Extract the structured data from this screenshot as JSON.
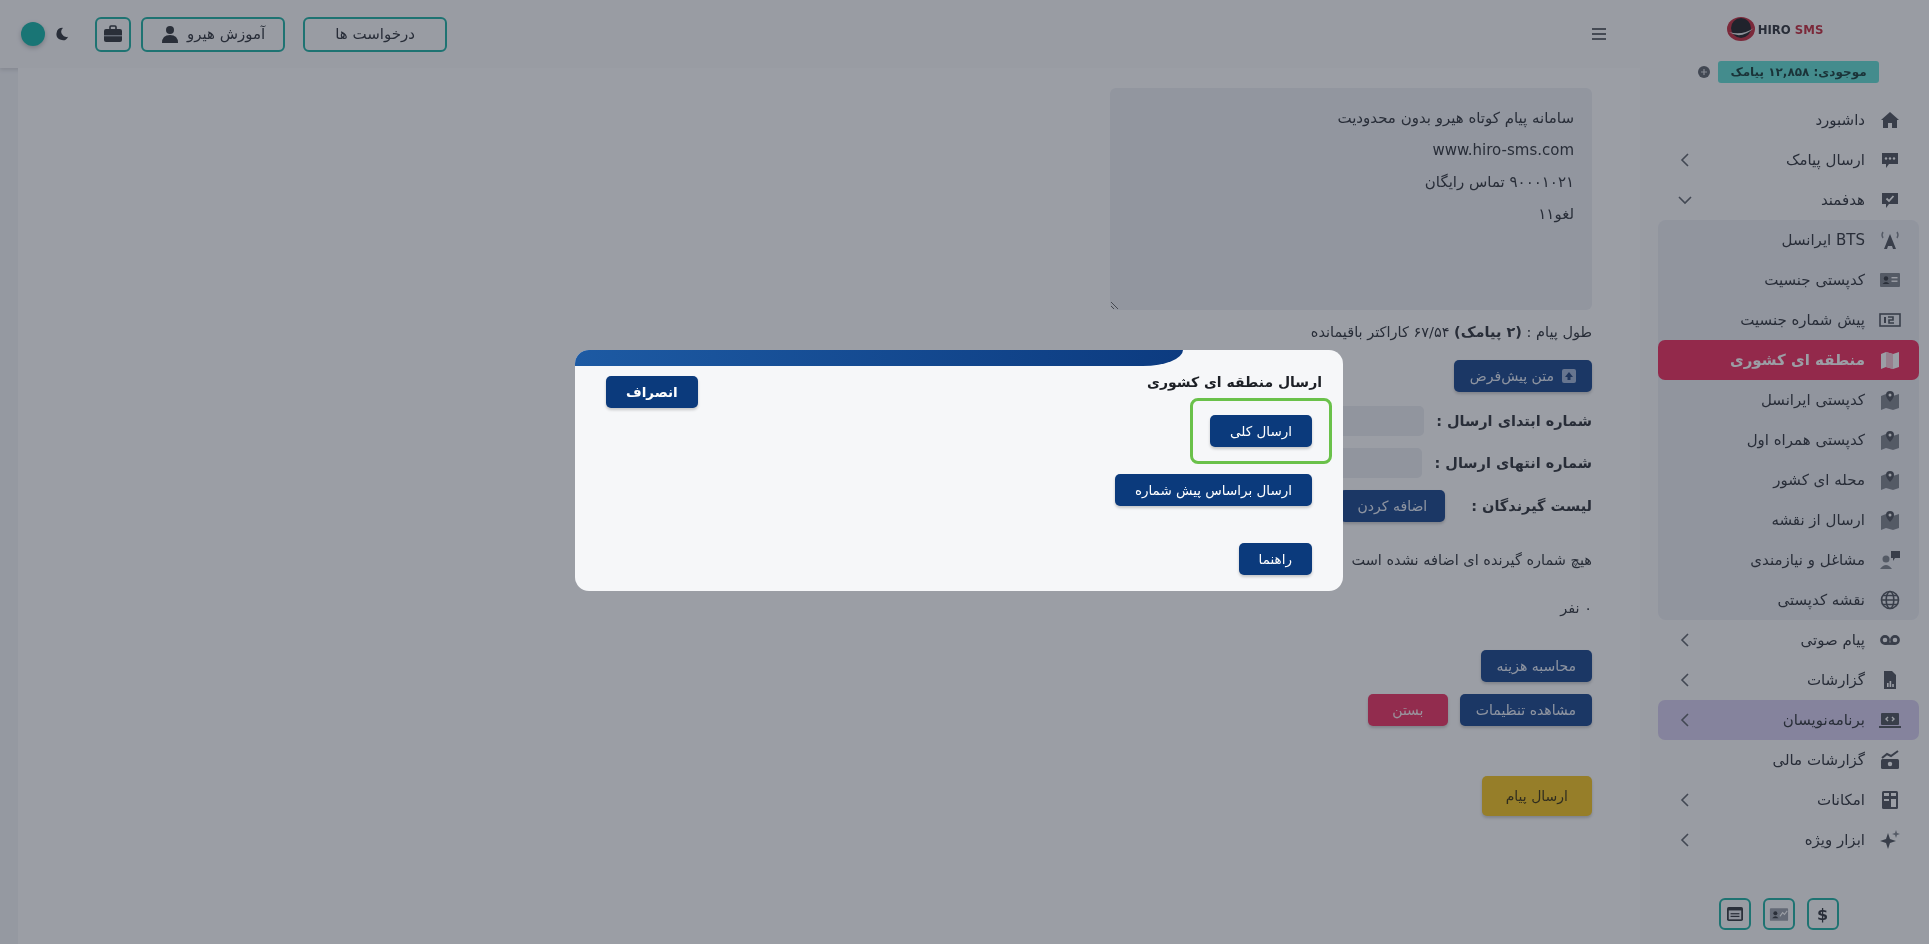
{
  "topbar": {
    "buttons": [
      {
        "kind": "text",
        "label": "درخواست ها"
      },
      {
        "kind": "icon_text",
        "label": "آموزش هیرو"
      },
      {
        "kind": "icon"
      }
    ]
  },
  "sidebar": {
    "logo": {
      "brand": "HIRO",
      "product": "SMS"
    },
    "balance": "موجودی: ۱۲,۸۵۸ پیامک",
    "items": [
      {
        "label": "داشبورد",
        "selected": false,
        "hovered": false,
        "expandable": false
      },
      {
        "label": "ارسال پیامک",
        "selected": false,
        "hovered": false,
        "expandable": true,
        "expanded": false
      },
      {
        "label": "هدفمند",
        "selected": false,
        "hovered": false,
        "expandable": true,
        "expanded": true,
        "children": [
          {
            "label": "BTS ایرانسل",
            "selected": false
          },
          {
            "label": "کدپستی جنسیت",
            "selected": false
          },
          {
            "label": "پیش شماره جنسیت",
            "selected": false
          },
          {
            "label": "منطقه ای کشوری",
            "selected": true
          },
          {
            "label": "کدپستی ایرانسل",
            "selected": false
          },
          {
            "label": "کدپستی همراه اول",
            "selected": false
          },
          {
            "label": "محله ای کشور",
            "selected": false
          },
          {
            "label": "ارسال از نقشه",
            "selected": false
          },
          {
            "label": "مشاغل و نیازمندی",
            "selected": false
          },
          {
            "label": "نقشه کدپستی",
            "selected": false
          }
        ]
      },
      {
        "label": "پیام صوتی",
        "selected": false,
        "hovered": false,
        "expandable": true,
        "expanded": false
      },
      {
        "label": "گزارشات",
        "selected": false,
        "hovered": false,
        "expandable": true,
        "expanded": false
      },
      {
        "label": "برنامه‌نویسان",
        "selected": false,
        "hovered": true,
        "expandable": true,
        "expanded": false
      },
      {
        "label": "گزارشات مالی",
        "selected": false,
        "hovered": false,
        "expandable": false
      },
      {
        "label": "امکانات",
        "selected": false,
        "hovered": false,
        "expandable": true,
        "expanded": false
      },
      {
        "label": "ابزار ویژه",
        "selected": false,
        "hovered": false,
        "expandable": true,
        "expanded": false
      }
    ],
    "footer_buttons": [
      {
        "kind": "text",
        "label": "$"
      },
      {
        "kind": "icon"
      },
      {
        "kind": "icon"
      }
    ]
  },
  "form": {
    "message": {
      "value": "سامانه پیام کوتاه هیرو بدون محدودیت\nwww.hiro-sms.com\n۹۰۰۰۱۰۲۱ تماس رایگان\nلغو۱۱"
    },
    "length_info": "طول پیام : **(۲ پیامک)** ۶۷/۵۴ کاراکتر باقیمانده",
    "default_text_button": "متن پیش‌فرض",
    "range_fields": [
      {
        "label": "شماره ابتدای ارسال :"
      },
      {
        "label": "شماره انتهای ارسال :"
      }
    ],
    "recipients": {
      "label": "لیست گیرندگان :",
      "add_button": "اضافه کردن",
      "empty_message": "هیچ شماره گیرنده ای اضافه نشده است",
      "count": "۰ نفر"
    },
    "action_rows": [
      [
        {
          "label": "محاسبه هزینه",
          "kind": "primary"
        }
      ],
      [
        {
          "label": "مشاهده تنظیمات",
          "kind": "primary"
        },
        {
          "label": "بستن",
          "kind": "danger"
        }
      ]
    ],
    "send_button": "ارسال پیام"
  },
  "modal": {
    "title": "ارسال منطقه ای کشوری",
    "cancel_button": "انصراف",
    "options": [
      {
        "label": "ارسال کلی",
        "highlighted": true
      },
      {
        "label": "ارسال براساس پیش شماره",
        "highlighted": false
      }
    ],
    "help_button": "راهنما"
  }
}
